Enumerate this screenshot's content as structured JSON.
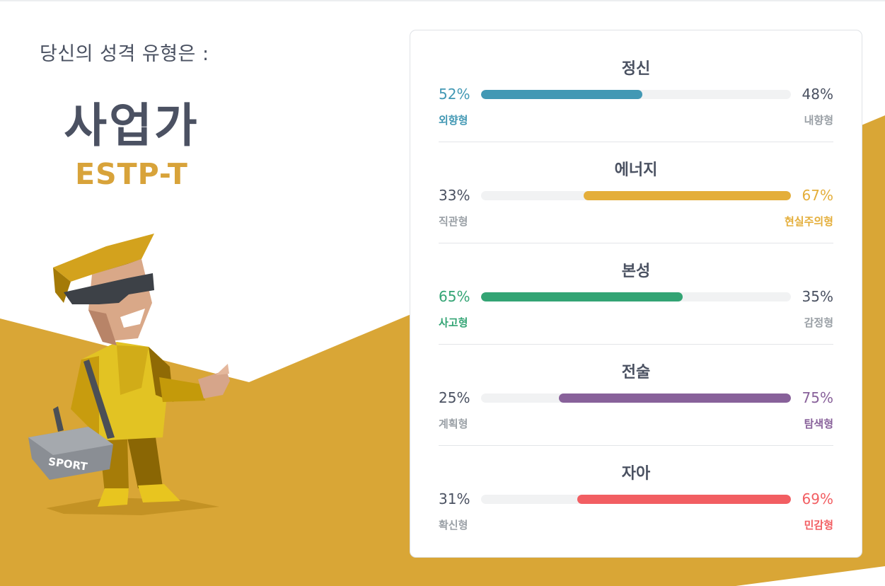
{
  "intro_text": "당신의 성격 유형은 :",
  "type_name": "사업가",
  "type_code": "ESTP-T",
  "character": {
    "bag_label": "SPORT"
  },
  "colors": {
    "accent": "#d8a636",
    "mind": "#4298b4",
    "energy": "#e4ae3a",
    "nature": "#33a474",
    "tactics": "#88619a",
    "identity": "#f25e62",
    "text": "#4a5161",
    "muted": "#9aa0a6"
  },
  "traits": [
    {
      "title": "정신",
      "left_pct": "52%",
      "right_pct": "48%",
      "left_label": "외향형",
      "right_label": "내향형",
      "fill_side": "left",
      "dominant_value": 52,
      "color_key": "mind"
    },
    {
      "title": "에너지",
      "left_pct": "33%",
      "right_pct": "67%",
      "left_label": "직관형",
      "right_label": "현실주의형",
      "fill_side": "right",
      "dominant_value": 67,
      "color_key": "energy"
    },
    {
      "title": "본성",
      "left_pct": "65%",
      "right_pct": "35%",
      "left_label": "사고형",
      "right_label": "감정형",
      "fill_side": "left",
      "dominant_value": 65,
      "color_key": "nature"
    },
    {
      "title": "전술",
      "left_pct": "25%",
      "right_pct": "75%",
      "left_label": "계획형",
      "right_label": "탐색형",
      "fill_side": "right",
      "dominant_value": 75,
      "color_key": "tactics"
    },
    {
      "title": "자아",
      "left_pct": "31%",
      "right_pct": "69%",
      "left_label": "확신형",
      "right_label": "민감형",
      "fill_side": "right",
      "dominant_value": 69,
      "color_key": "identity"
    }
  ]
}
